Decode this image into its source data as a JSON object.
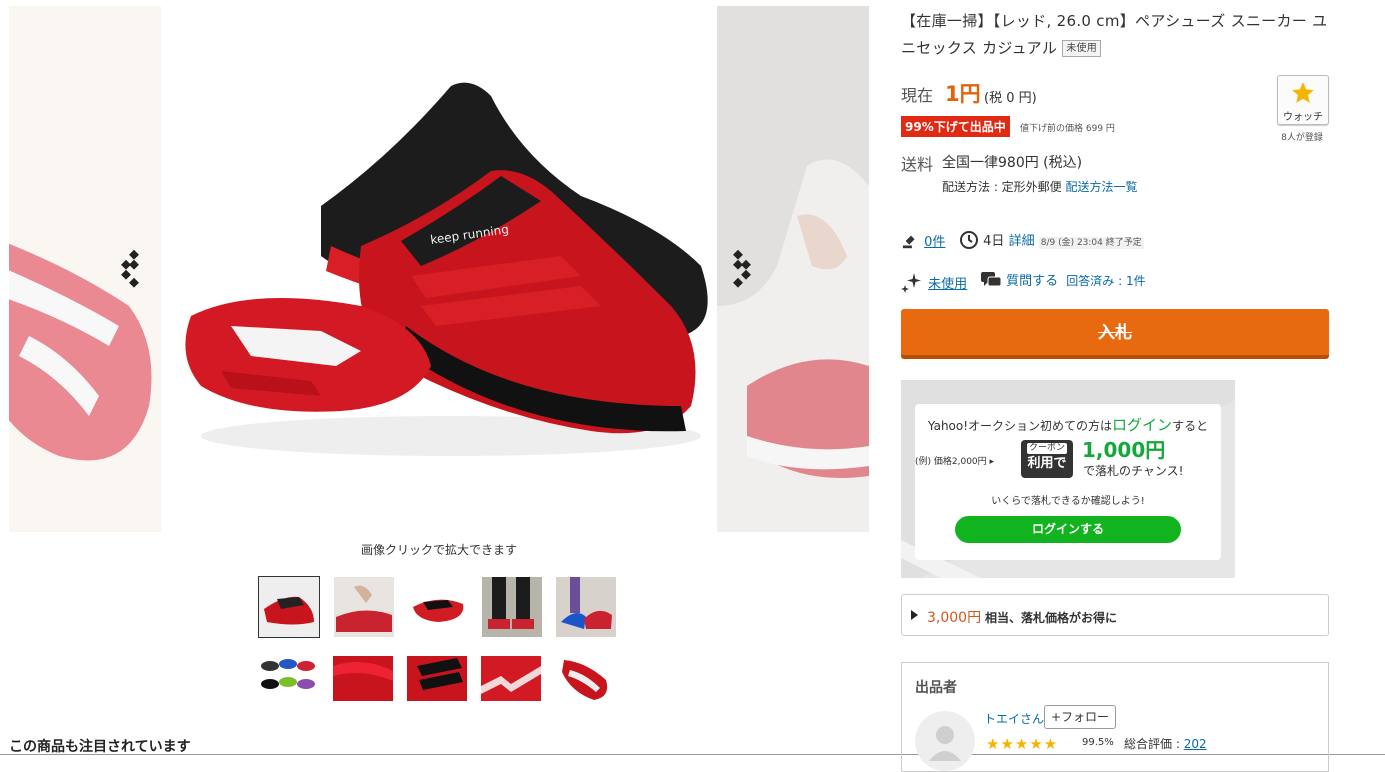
{
  "gallery": {
    "caption": "画像クリックで拡大できます",
    "main_image_text": "keep running"
  },
  "also_viewed": "この商品も注目されています",
  "item": {
    "title": "【在庫一掃】【レッド, 26.0 cm】ペアシューズ スニーカー ユニセックス カジュアル",
    "condition_badge": "未使用"
  },
  "price": {
    "label": "現在",
    "value": "1円",
    "tax": "(税 0 円)",
    "discount_badge": "99%下げて出品中",
    "original": "値下げ前の価格 699 円"
  },
  "watch": {
    "label": "ウォッチ",
    "count": "8人が登録"
  },
  "shipping": {
    "label": "送料",
    "value": "全国一律980円 (税込)",
    "method_label": "配送方法 : 定形外郵便",
    "method_link": "配送方法一覧"
  },
  "stats": {
    "bids": "0件",
    "remaining": "4日",
    "detail_link": "詳細",
    "end_time": "8/9 (金) 23:04 終了予定",
    "condition_link": "未使用",
    "question_link": "質問する",
    "answered_link": "回答済み : 1件"
  },
  "bid_button": "入札",
  "promo": {
    "line1_pre": "Yahoo!オークション初めての方は",
    "line1_login": "ログイン",
    "line1_post": "すると",
    "regular_price": "(例) 価格2,000円",
    "coupon_top": "クーポン",
    "coupon_bottom": "利用で",
    "amount": "1,000円",
    "chance": "で落札のチャンス!",
    "check": "いくらで落札できるか確認しよう!",
    "login_button": "ログインする"
  },
  "savings": {
    "amount": "3,000円",
    "text": "相当、落札価格がお得に"
  },
  "seller": {
    "heading": "出品者",
    "name": "トエイさん",
    "follow": "+フォロー",
    "stars": "★★★★★",
    "rating_pct": "99.5%",
    "total_label": "総合評価 : ",
    "total_value": "202"
  },
  "colors": {
    "accent_orange": "#e76a11",
    "price_orange": "#e4620b",
    "discount_red": "#e02a14",
    "promo_green": "#11b31e",
    "link_blue": "#0a6aa8"
  }
}
